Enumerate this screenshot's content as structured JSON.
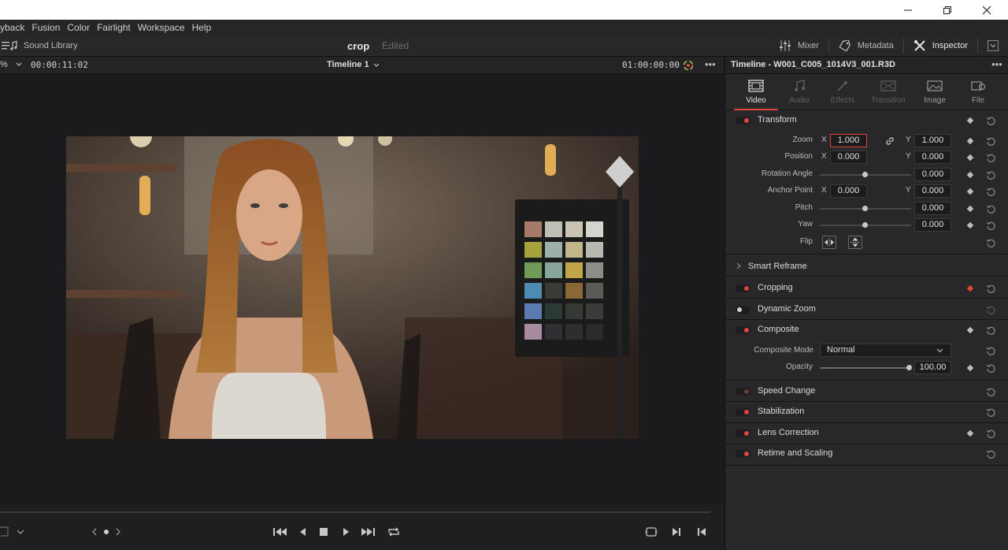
{
  "menu": [
    "yback",
    "Fusion",
    "Color",
    "Fairlight",
    "Workspace",
    "Help"
  ],
  "toolbar": {
    "sound_library": "Sound Library",
    "project_name": "crop",
    "project_status": "Edited",
    "mixer": "Mixer",
    "metadata": "Metadata",
    "inspector": "Inspector"
  },
  "viewer": {
    "zoom": "%",
    "source_timecode": "00:00:11:02",
    "timeline_name": "Timeline 1",
    "record_timecode": "01:00:00:00"
  },
  "inspector": {
    "clip_title": "Timeline - W001_C005_1014V3_001.R3D",
    "tabs": [
      {
        "label": "Video",
        "active": true
      },
      {
        "label": "Audio",
        "active": false
      },
      {
        "label": "Effects",
        "active": false
      },
      {
        "label": "Transition",
        "active": false
      },
      {
        "label": "Image",
        "active": false
      },
      {
        "label": "File",
        "active": false
      }
    ],
    "transform": {
      "title": "Transform",
      "zoom_label": "Zoom",
      "zoom_x": "1.000",
      "zoom_y": "1.000",
      "position_label": "Position",
      "position_x": "0.000",
      "position_y": "0.000",
      "rotation_label": "Rotation Angle",
      "rotation": "0.000",
      "anchor_label": "Anchor Point",
      "anchor_x": "0.000",
      "anchor_y": "0.000",
      "pitch_label": "Pitch",
      "pitch": "0.000",
      "yaw_label": "Yaw",
      "yaw": "0.000",
      "flip_label": "Flip",
      "x": "X",
      "y": "Y"
    },
    "smart_reframe": "Smart Reframe",
    "cropping": "Cropping",
    "dynamic_zoom": "Dynamic Zoom",
    "composite": {
      "title": "Composite",
      "mode_label": "Composite Mode",
      "mode_value": "Normal",
      "opacity_label": "Opacity",
      "opacity": "100.00"
    },
    "speed_change": "Speed Change",
    "stabilization": "Stabilization",
    "lens_correction": "Lens Correction",
    "retime_scaling": "Retime and Scaling"
  },
  "colors": {
    "accent": "#e0453a",
    "panel": "#28282b",
    "background": "#1a1a1c"
  }
}
